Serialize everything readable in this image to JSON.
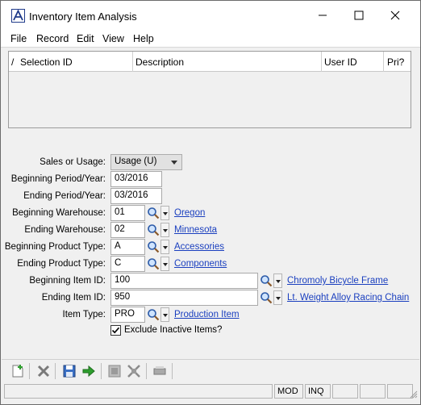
{
  "window": {
    "title": "Inventory Item Analysis"
  },
  "menu": [
    "File",
    "Record",
    "Edit",
    "View",
    "Help"
  ],
  "grid": {
    "columns": [
      {
        "label": "Selection ID"
      },
      {
        "label": "Description"
      },
      {
        "label": "User ID"
      },
      {
        "label": "Pri?"
      }
    ],
    "sort_marker": "/"
  },
  "form": {
    "sales_usage": {
      "label": "Sales or Usage:",
      "value": "Usage (U)"
    },
    "beginning_period": {
      "label": "Beginning Period/Year:",
      "value": "03/2016"
    },
    "ending_period": {
      "label": "Ending Period/Year:",
      "value": "03/2016"
    },
    "beginning_warehouse": {
      "label": "Beginning Warehouse:",
      "value": "01",
      "desc": "Oregon"
    },
    "ending_warehouse": {
      "label": "Ending Warehouse:",
      "value": "02",
      "desc": "Minnesota"
    },
    "beginning_product_type": {
      "label": "Beginning Product Type:",
      "value": "A",
      "desc": "Accessories"
    },
    "ending_product_type": {
      "label": "Ending Product Type:",
      "value": "C",
      "desc": "Components"
    },
    "beginning_item": {
      "label": "Beginning Item ID:",
      "value": "100",
      "desc": "Chromoly Bicycle Frame"
    },
    "ending_item": {
      "label": "Ending Item ID:",
      "value": "950",
      "desc": "Lt. Weight Alloy Racing Chain"
    },
    "item_type": {
      "label": "Item Type:",
      "value": "PRO",
      "desc": "Production Item"
    },
    "exclude_inactive": {
      "label": "Exclude Inactive Items?",
      "checked": true
    }
  },
  "toolbar": [
    "new-icon",
    "delete-icon",
    "save-icon",
    "next-icon",
    "first-icon",
    "last-icon",
    "print-icon"
  ],
  "status": {
    "mode": "MOD",
    "inq": "INQ"
  },
  "colors": {
    "link": "#1a3fbf",
    "accent": "#1f3a8a",
    "background": "#f0f0f0"
  }
}
